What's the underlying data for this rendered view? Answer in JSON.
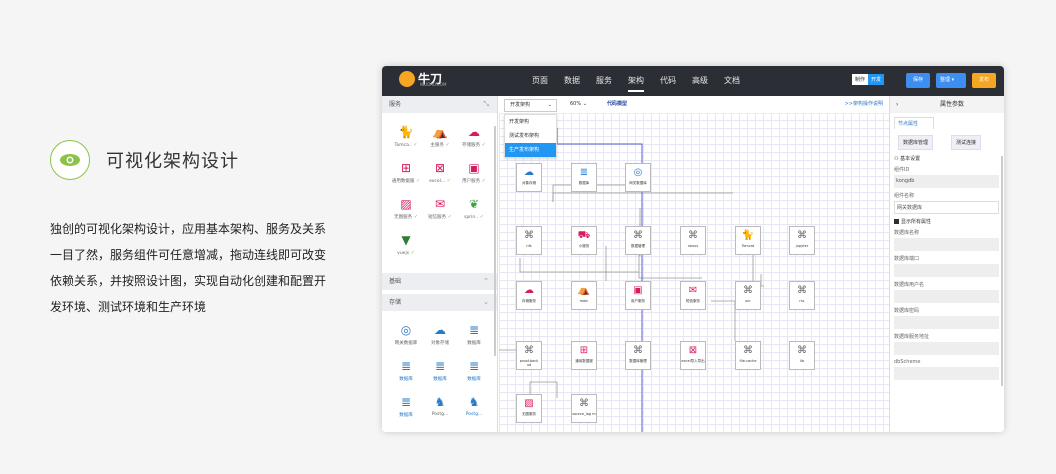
{
  "feature": {
    "title": "可视化架构设计",
    "description": "独创的可视化架构设计，应用基本架构、服务及关系一目了然，服务组件可任意增减，拖动连线即可改变依赖关系，并按照设计图，实现自动化创建和配置开发环境、测试环境和生产环境"
  },
  "app": {
    "logo_text": "牛刀",
    "logo_sub": "NIUDAO.COM",
    "nav": [
      "页面",
      "数据",
      "服务",
      "架构",
      "代码",
      "高级",
      "文档"
    ],
    "active_nav": "架构",
    "mode_toggle": {
      "on": "制作",
      "off": "开发"
    },
    "save_label": "保存",
    "tidy_label": "整理",
    "publish_label": "发布"
  },
  "left_panel": {
    "services_header": "服务",
    "services": [
      {
        "icon": "tomcat-icon",
        "label": "Tomca..",
        "color": "#d81b60"
      },
      {
        "icon": "host-icon",
        "label": "主服务",
        "color": "#d81b60"
      },
      {
        "icon": "storage-icon",
        "label": "存储服务",
        "color": "#d81b60"
      },
      {
        "icon": "office-icon",
        "label": "通用数据服",
        "color": "#d81b60"
      },
      {
        "icon": "excel-icon",
        "label": "excel...",
        "color": "#d81b60"
      },
      {
        "icon": "user-icon",
        "label": "用户服务",
        "color": "#d81b60"
      },
      {
        "icon": "image-icon",
        "label": "无图服务",
        "color": "#d81b60"
      },
      {
        "icon": "mail-icon",
        "label": "短信服务",
        "color": "#d81b60"
      },
      {
        "icon": "spring-icon",
        "label": "sprin..",
        "color": "#43a047"
      },
      {
        "icon": "vue-icon",
        "label": "vuejs",
        "color": "#2e7d32"
      }
    ],
    "basic_header": "基础",
    "storage_header": "存储",
    "storage": [
      {
        "icon": "network-db-icon",
        "label": "网关数据库",
        "blue": false
      },
      {
        "icon": "object-storage-icon",
        "label": "对象存储",
        "blue": false
      },
      {
        "icon": "database-icon",
        "label": "数据库",
        "blue": false
      },
      {
        "icon": "database-icon",
        "label": "数据库",
        "blue": true
      },
      {
        "icon": "database-icon",
        "label": "数据库",
        "blue": true
      },
      {
        "icon": "database-icon",
        "label": "数据库",
        "blue": true
      },
      {
        "icon": "database-icon",
        "label": "数据库",
        "blue": true
      },
      {
        "icon": "postgres-icon",
        "label": "Postg...",
        "blue": false
      },
      {
        "icon": "postgres-icon",
        "label": "Postg...",
        "blue": true
      }
    ]
  },
  "canvas": {
    "env_select": "开发架构",
    "zoom": "60%",
    "code_model": "代码模型",
    "arch_help": ">>架构操作说明",
    "env_options": [
      "开发架构",
      "测试发布架构",
      "生产发布架构"
    ],
    "selected_env": "生产发布架构",
    "nodes": [
      {
        "id": "n1",
        "label": "对象存储",
        "icon": "object-storage-icon"
      },
      {
        "id": "n2",
        "label": "数据库",
        "icon": "database-icon"
      },
      {
        "id": "n3",
        "label": "网关数据库",
        "icon": "network-db-icon"
      },
      {
        "id": "n4",
        "label": "nfs",
        "icon": "command-icon"
      },
      {
        "id": "n5",
        "label": "小服务",
        "icon": "cart-icon"
      },
      {
        "id": "n6",
        "label": "数据管理",
        "icon": "command-icon"
      },
      {
        "id": "n7",
        "label": "nexus",
        "icon": "command-icon"
      },
      {
        "id": "n8",
        "label": "Tomcat",
        "icon": "tomcat-icon"
      },
      {
        "id": "n9",
        "label": "jupyter",
        "icon": "command-icon"
      },
      {
        "id": "n10",
        "label": "存储服务",
        "icon": "storage-icon"
      },
      {
        "id": "n11",
        "label": "main",
        "icon": "host-icon"
      },
      {
        "id": "n12",
        "label": "用户服务",
        "icon": "user-icon"
      },
      {
        "id": "n13",
        "label": "短信服务",
        "icon": "mail-icon"
      },
      {
        "id": "n14",
        "label": "ocr",
        "icon": "command-icon"
      },
      {
        "id": "n15",
        "label": "rsc",
        "icon": "command-icon"
      },
      {
        "id": "n16",
        "label": "proof-back ud",
        "icon": "command-icon"
      },
      {
        "id": "n17",
        "label": "通用数据服",
        "icon": "office-icon"
      },
      {
        "id": "n18",
        "label": "数据库管理",
        "icon": "command-icon"
      },
      {
        "id": "n19",
        "label": "excel导入导出",
        "icon": "excel-icon"
      },
      {
        "id": "n20",
        "label": "file-cache",
        "icon": "command-icon"
      },
      {
        "id": "n21",
        "label": "lib",
        "icon": "command-icon"
      },
      {
        "id": "n22",
        "label": "无图服务",
        "icon": "image-icon"
      },
      {
        "id": "n23",
        "label": "source_log m",
        "icon": "command-icon"
      }
    ]
  },
  "right_panel": {
    "header": "属性参数",
    "tab": "节点属性",
    "btn_db_manage": "数据库管理",
    "btn_test_connect": "测试连接",
    "section_basic": "基本设置",
    "component_id_label": "组件ID",
    "component_id_value": "kongdb",
    "component_name_label": "组件名称",
    "component_name_value": "网关数据库",
    "show_all_label": "显示所有属性",
    "db_name_label": "数据库名称",
    "db_port_label": "数据库端口",
    "db_user_label": "数据库用户名",
    "db_password_label": "数据库密码",
    "db_host_label": "数据库服务地址",
    "db_scheme_label": "dbScheme"
  }
}
